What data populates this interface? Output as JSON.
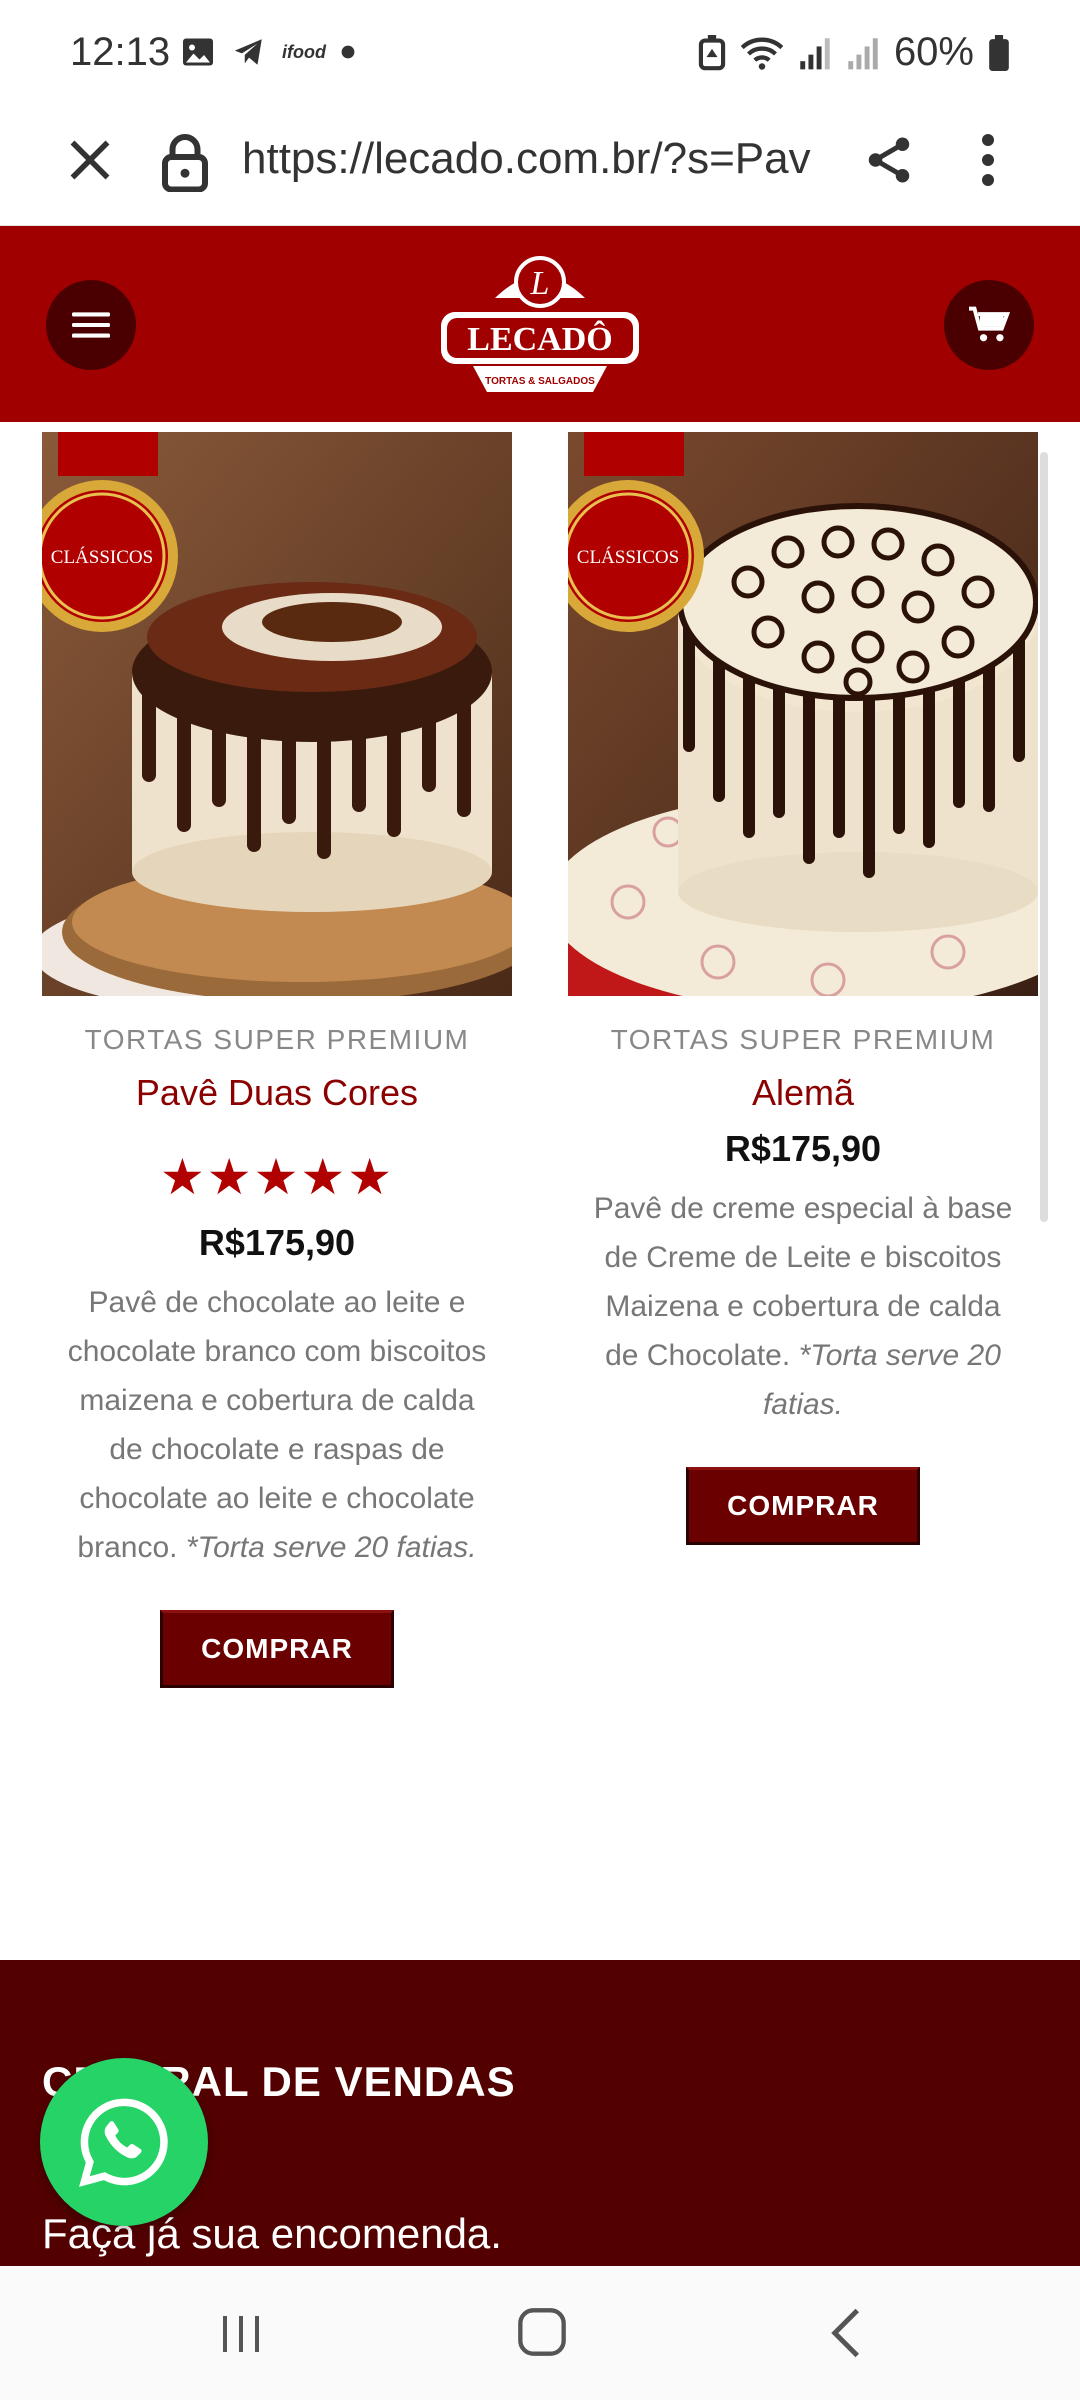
{
  "status_bar": {
    "time": "12:13",
    "battery": "60%",
    "left_icons": [
      "image-icon",
      "telegram-icon",
      "ifood-icon",
      "dot-icon"
    ],
    "right_icons": [
      "alarm-icon",
      "wifi-icon",
      "signal-icon",
      "signal-icon",
      "battery-icon"
    ],
    "ifood_label": "ifood"
  },
  "browser": {
    "url": "https://lecado.com.br/?s=Pav"
  },
  "header": {
    "brand": "LECADÔ",
    "tagline": "TORTAS & SALGADOS",
    "brand_color": "#a00000"
  },
  "products": [
    {
      "badge": "CLÁSSICOS",
      "category": "TORTAS SUPER PREMIUM",
      "name": "Pavê Duas Cores",
      "stars": "★★★★★",
      "rating": 5,
      "price": "R$175,90",
      "description": "Pavê de chocolate ao leite e chocolate branco com biscoitos maizena e cobertura de calda de chocolate e raspas de chocolate ao leite e chocolate branco.",
      "note": "*Torta serve 20 fatias.",
      "button": "COMPRAR"
    },
    {
      "badge": "CLÁSSICOS",
      "category": "TORTAS SUPER PREMIUM",
      "name": "Alemã",
      "price": "R$175,90",
      "description": "Pavê de creme especial à base de Creme de Leite e biscoitos Maizena e cobertura de calda de Chocolate.",
      "note": "*Torta serve 20 fatias.",
      "button": "COMPRAR"
    }
  ],
  "footer": {
    "title": "CENTRAL DE VENDAS",
    "subtitle": "Faça já sua encomenda."
  },
  "colors": {
    "accent": "#a00000",
    "dark_red": "#520000",
    "button": "#6b0000",
    "whatsapp": "#25d366"
  }
}
